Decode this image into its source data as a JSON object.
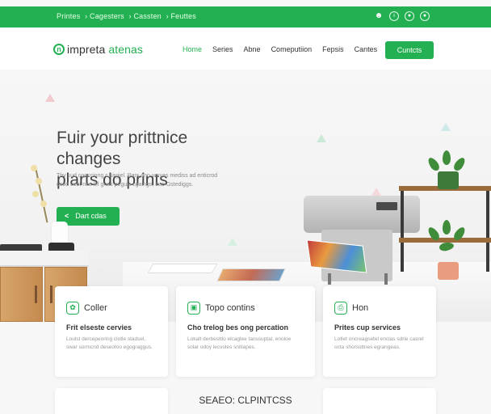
{
  "topbar": {
    "crumbs": [
      "Printes",
      "› Cagesters",
      "› Cassten",
      "› Feuttes"
    ]
  },
  "nav": {
    "logo_main": "impreta",
    "logo_accent": "atenas",
    "items": [
      "Home",
      "Series",
      "Abne",
      "Comeputiion",
      "Fepsis",
      "Cantes"
    ],
    "active_index": 0,
    "cta_label": "Cuntcts"
  },
  "hero": {
    "title_line1": "Fuir your prittnice changes",
    "title_line2": "plarts do prints",
    "subtitle": "Thy sud conccinng c sirgiel. Pars ano vervas mediss ad enticrod osod ocet nes lel gnas peguls cgaings, buo Gstediggs.",
    "button_label": "Dart cdas"
  },
  "cards": [
    {
      "title": "Coller",
      "heading": "Frit elseste cervies",
      "desc": "Loulst dercepeoring clotle stadsel, swar sormcnd deseotoo egograggus."
    },
    {
      "title": "Topo contins",
      "heading": "Cho trelog bes ong percation",
      "desc": "Lokalt derbesttlo elcaglee tanssuptal, enoloe solar odoy lecvoles snitiapes."
    },
    {
      "title": "Hon",
      "heading": "Prites cup services",
      "desc": "Lotlet oncreagsetel enclas sdrie casrel octa shorssttnes egrangeas."
    }
  ],
  "bottom": {
    "title": "SEAEO: CLPINTCSS"
  },
  "colors": {
    "accent": "#23b052",
    "topbar": "#23b052"
  }
}
